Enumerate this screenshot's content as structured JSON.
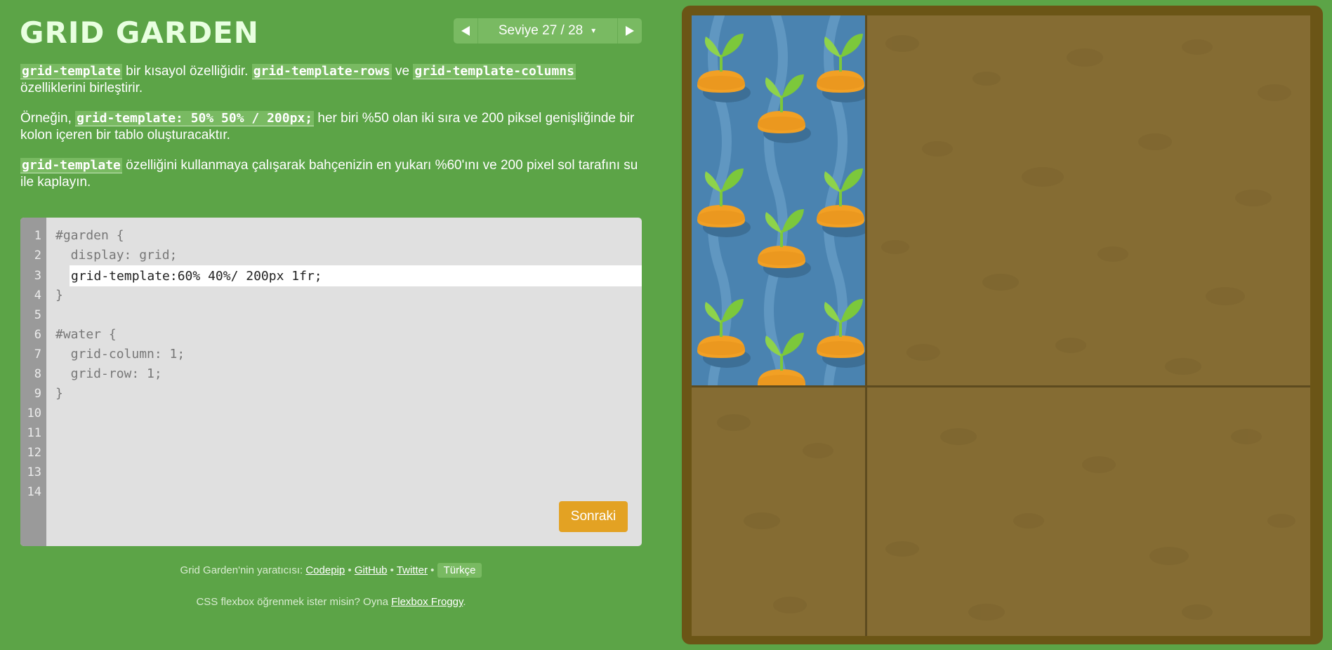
{
  "title": "GRID GARDEN",
  "level_nav": {
    "label": "Seviye 27 / 28",
    "prev_icon": "left-triangle-icon",
    "next_icon": "right-triangle-icon",
    "dropdown_icon": "caret-down-icon"
  },
  "instructions": {
    "p1": {
      "code1": "grid-template",
      "text1": " bir kısayol özelliğidir. ",
      "code2": "grid-template-rows",
      "text2": " ve ",
      "code3": "grid-template-columns",
      "text3": " özelliklerini birleştirir."
    },
    "p2": {
      "text1": "Örneğin, ",
      "code1": "grid-template: 50% 50% / 200px;",
      "text2": " her biri %50 olan iki sıra ve 200 piksel genişliğinde bir kolon içeren bir tablo oluşturacaktır."
    },
    "p3": {
      "code1": "grid-template",
      "text1": " özelliğini kullanmaya çalışarak bahçenizin en yukarı %60'ını ve 200 pixel sol tarafını su ile kaplayın."
    }
  },
  "editor": {
    "line_numbers": [
      "1",
      "2",
      "3",
      "4",
      "5",
      "6",
      "7",
      "8",
      "9",
      "10",
      "11",
      "12",
      "13",
      "14"
    ],
    "lines": {
      "l1": "#garden {",
      "l2": "  display: grid;",
      "l4": "}",
      "l6": "#water {",
      "l7": "  grid-column: 1;",
      "l8": "  grid-row: 1;",
      "l9": "}"
    },
    "input_value": "grid-template:60% 40%/ 200px 1fr;",
    "next_label": "Sonraki"
  },
  "credits": {
    "prefix": "Grid Garden'nin yaratıcısı: ",
    "codepip": "Codepip",
    "github": "GitHub",
    "twitter": "Twitter",
    "separator": " • ",
    "language": "Türkçe"
  },
  "froggy": {
    "prefix": "CSS flexbox öğrenmek ister misin? Oyna ",
    "link": "Flexbox Froggy",
    "suffix": "."
  },
  "colors": {
    "background": "#5ca447",
    "soil": "#856c33",
    "frame": "#6b5516",
    "water": "#4a83b0",
    "button": "#e3a223"
  }
}
